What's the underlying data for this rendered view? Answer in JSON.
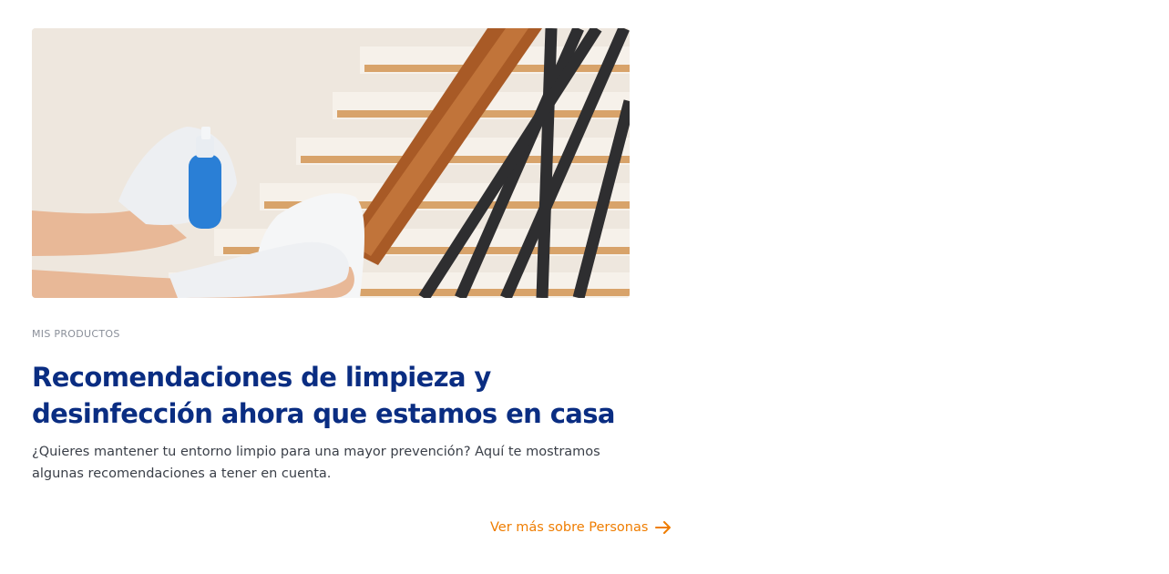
{
  "card": {
    "image_alt": "hands-in-gloves-cleaning-handrail",
    "category": "MIS PRODUCTOS",
    "title": "Recomendaciones de limpieza y desinfección ahora que estamos en casa",
    "description": "¿Quieres mantener tu entorno limpio para una mayor prevención? Aquí te mostramos algunas recomendaciones a tener en cuenta."
  },
  "footer_link": {
    "label": "Ver más sobre Personas",
    "icon": "arrow-right-icon"
  },
  "colors": {
    "title": "#0a2d82",
    "link": "#ef7d00",
    "category": "#8a8f99",
    "text": "#3a3f48"
  }
}
